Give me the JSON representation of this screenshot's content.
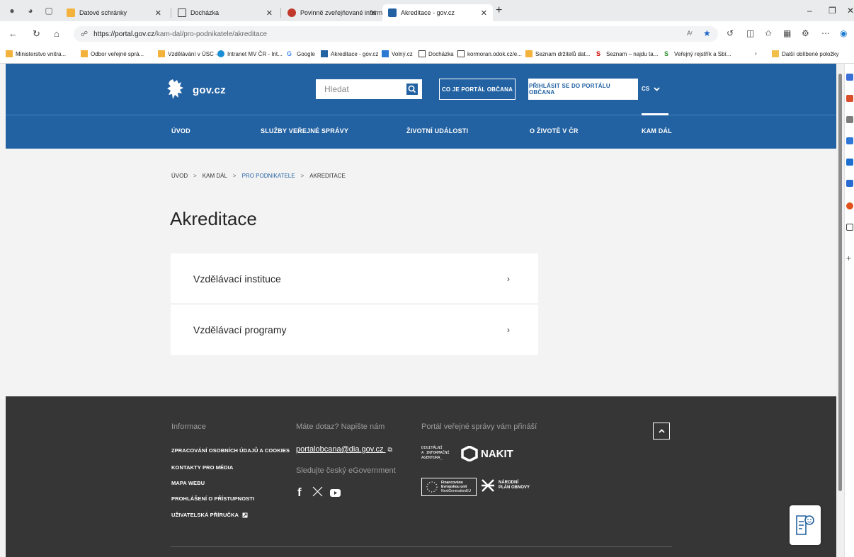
{
  "browser": {
    "tabs": [
      {
        "label": "Datové schránky"
      },
      {
        "label": "Docházka"
      },
      {
        "label": "Povinně zveřejňované informace |"
      },
      {
        "label": "Akreditace - gov.cz",
        "active": true
      }
    ],
    "url_host": "https://portal.gov.cz",
    "url_path": "/kam-dal/pro-podnikatele/akreditace",
    "favorites": [
      "Ministerstvo vnitra...",
      "Odbor veřejné sprá...",
      "Vzdělávání v ÚSC -...",
      "Intranet MV ČR - Int...",
      "Google",
      "Akreditace - gov.cz",
      "Volný.cz",
      "Docházka",
      "kormoran.odok.cz/e...",
      "Seznam držitelů dat...",
      "Seznam – najdu ta...",
      "Veřejný rejstřík a Sbí..."
    ],
    "more_favorites": "Další oblíbené položky",
    "read_aloud": "Aʳ"
  },
  "header": {
    "logo_text": "gov.cz",
    "search_placeholder": "Hledat",
    "btn_about": "CO JE PORTÁL OBČANA",
    "btn_login": "PŘIHLÁSIT SE DO PORTÁLU OBČANA",
    "lang": "CS"
  },
  "nav": {
    "items": [
      "ÚVOD",
      "SLUŽBY VEŘEJNÉ SPRÁVY",
      "ŽIVOTNÍ UDÁLOSTI",
      "O ŽIVOTĚ V ČR",
      "KAM DÁL"
    ],
    "active": "KAM DÁL"
  },
  "breadcrumb": [
    "ÚVOD",
    "KAM DÁL",
    "PRO PODNIKATELE",
    "AKREDITACE"
  ],
  "main": {
    "title": "Akreditace",
    "items": [
      {
        "label": "Vzdělávací instituce"
      },
      {
        "label": "Vzdělávací programy"
      }
    ]
  },
  "footer": {
    "info_heading": "Informace",
    "links": [
      "ZPRACOVÁNÍ OSOBNÍCH ÚDAJŮ A COOKIES",
      "KONTAKTY PRO MÉDIA",
      "MAPA WEBU",
      "PROHLÁŠENÍ O PŘÍSTUPNOSTI",
      "UŽIVATELSKÁ PŘÍRUČKA"
    ],
    "contact_heading": "Máte dotaz? Napište nám",
    "email": "portalobcana@dia.gov.cz",
    "egov_heading": "Sledujte český eGovernment",
    "partners_heading": "Portál veřejné správy vám přináší",
    "dia_lines": [
      "DIGITÁLNÍ",
      "A INFORMAČNÍ",
      "AGENTURA_"
    ],
    "nakit": "NAKIT",
    "eu_lines": [
      "Financováno",
      "Evropskou unií",
      "NextGenerationEU"
    ],
    "npo_lines": [
      "NÁRODNÍ",
      "PLÁN OBNOVY"
    ]
  },
  "colors": {
    "brand_blue": "#2362a2",
    "footer_bg": "#363636",
    "page_bg": "#f3f3f3"
  }
}
